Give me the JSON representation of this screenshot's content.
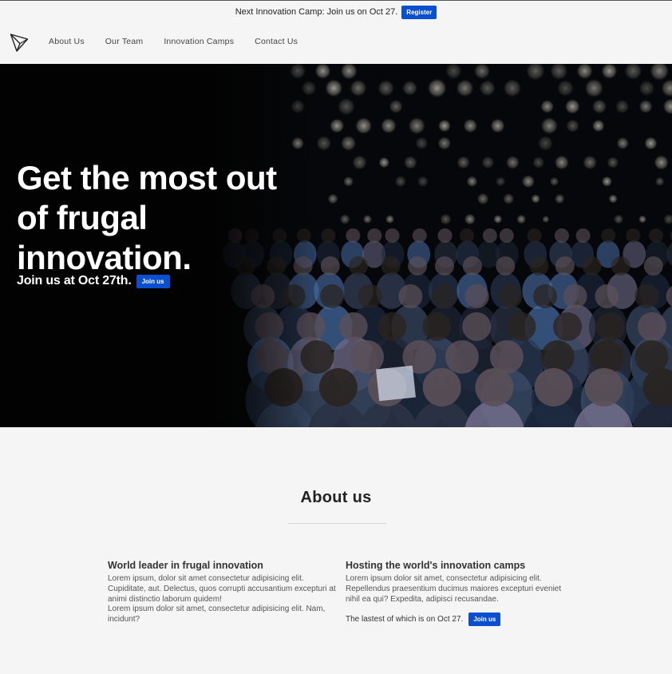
{
  "announcement": {
    "text": "Next Innovation Camp: Join us on Oct 27.",
    "button_label": "Register"
  },
  "nav": {
    "logo_icon": "paper-plane-icon",
    "links": [
      "About Us",
      "Our Team",
      "Innovation Camps",
      "Contact Us"
    ]
  },
  "hero": {
    "title_lines": [
      "Get the most out",
      "of frugal",
      "innovation."
    ],
    "subtitle": "Join us at Oct 27th.",
    "button_label": "Join us"
  },
  "about": {
    "title": "About us",
    "left": {
      "heading": "World leader in frugal innovation",
      "paragraphs": [
        "Lorem ipsum, dolor sit amet consectetur adipisicing elit. Cupiditate, aut. Delectus, quos corrupti accusantium excepturi at animi distinctio laborum quidem!",
        "Lorem ipsum dolor sit amet, consectetur adipisicing elit. Nam, incidunt?"
      ]
    },
    "right": {
      "heading": "Hosting the world's innovation camps",
      "paragraph": "Lorem ipsum dolor sit amet, consectetur adipisicing elit. Repellendus praesentium ducimus maiores excepturi eveniet nihil ea qui? Expedita, adipisci recusandae.",
      "footer_text": "The lastest of which is on Oct 27.",
      "button_label": "Join us"
    }
  },
  "colors": {
    "accent": "#0b4fd1",
    "page_background": "#f5f5f5",
    "hero_background": "#020202"
  }
}
